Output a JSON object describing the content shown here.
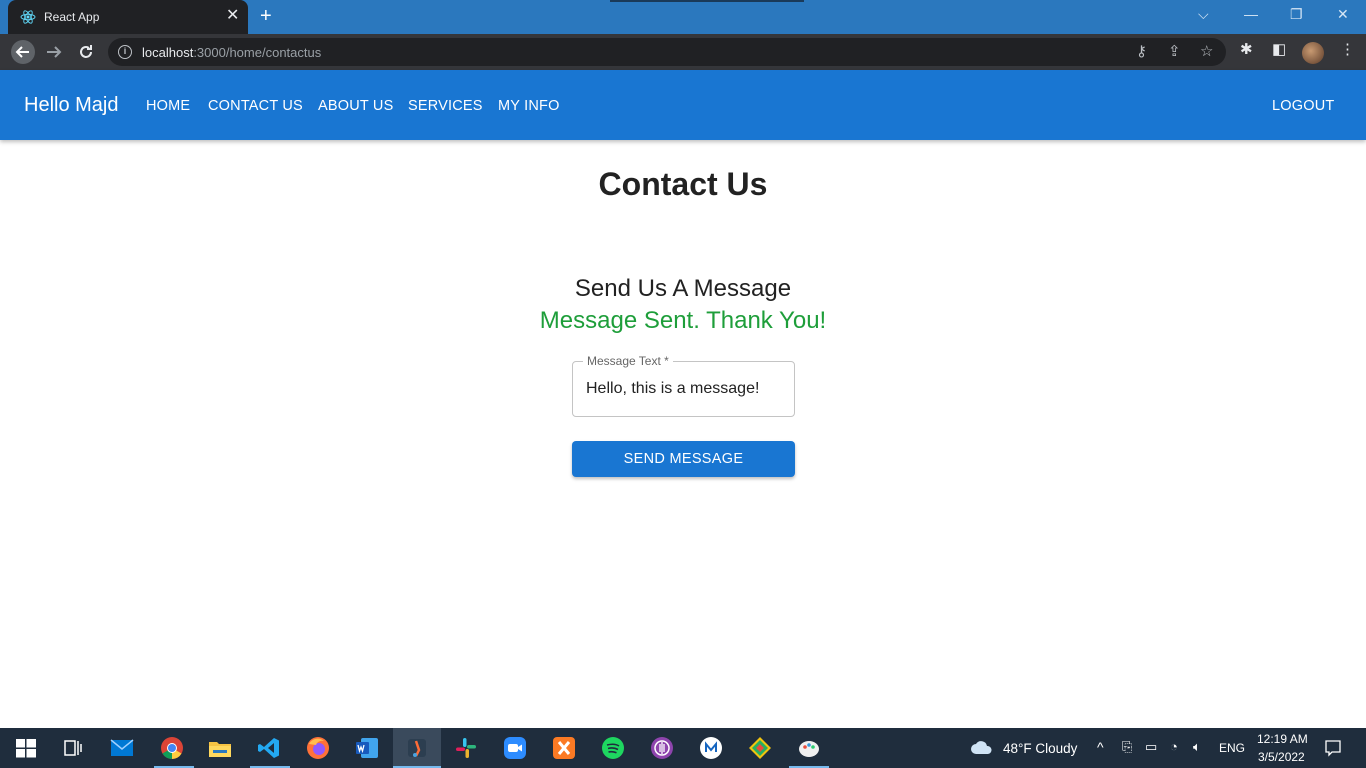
{
  "browser": {
    "tab_title": "React App",
    "tab_close": "✕",
    "new_tab": "+",
    "url_host": "localhost",
    "url_rest": ":3000/home/contactus",
    "window_controls": {
      "minimize": "—",
      "restore": "❐",
      "close": "✕",
      "search_tabs": "⌵"
    }
  },
  "appbar": {
    "brand": "Hello Majd",
    "nav": [
      "HOME",
      "CONTACT US",
      "ABOUT US",
      "SERVICES",
      "MY INFO"
    ],
    "logout": "LOGOUT",
    "color": "#1976d2"
  },
  "main": {
    "title": "Contact Us",
    "form_title": "Send Us A Message",
    "success_message": "Message Sent. Thank You!",
    "success_color": "#1e9e3a",
    "field_label": "Message Text *",
    "field_value": "Hello, this is a message!",
    "submit_label": "SEND MESSAGE"
  },
  "taskbar": {
    "apps": [
      "windows-start-icon",
      "task-view-icon",
      "mail-icon",
      "chrome-icon",
      "file-explorer-icon",
      "vscode-icon",
      "firefox-icon",
      "word-icon",
      "postman-icon",
      "slack-icon",
      "zoom-icon",
      "xampp-icon",
      "spotify-icon",
      "podcasts-icon",
      "app-icon",
      "git-icon",
      "paint-icon"
    ],
    "weather": "48°F  Cloudy",
    "language": "ENG",
    "time": "12:19 AM",
    "date": "3/5/2022"
  }
}
